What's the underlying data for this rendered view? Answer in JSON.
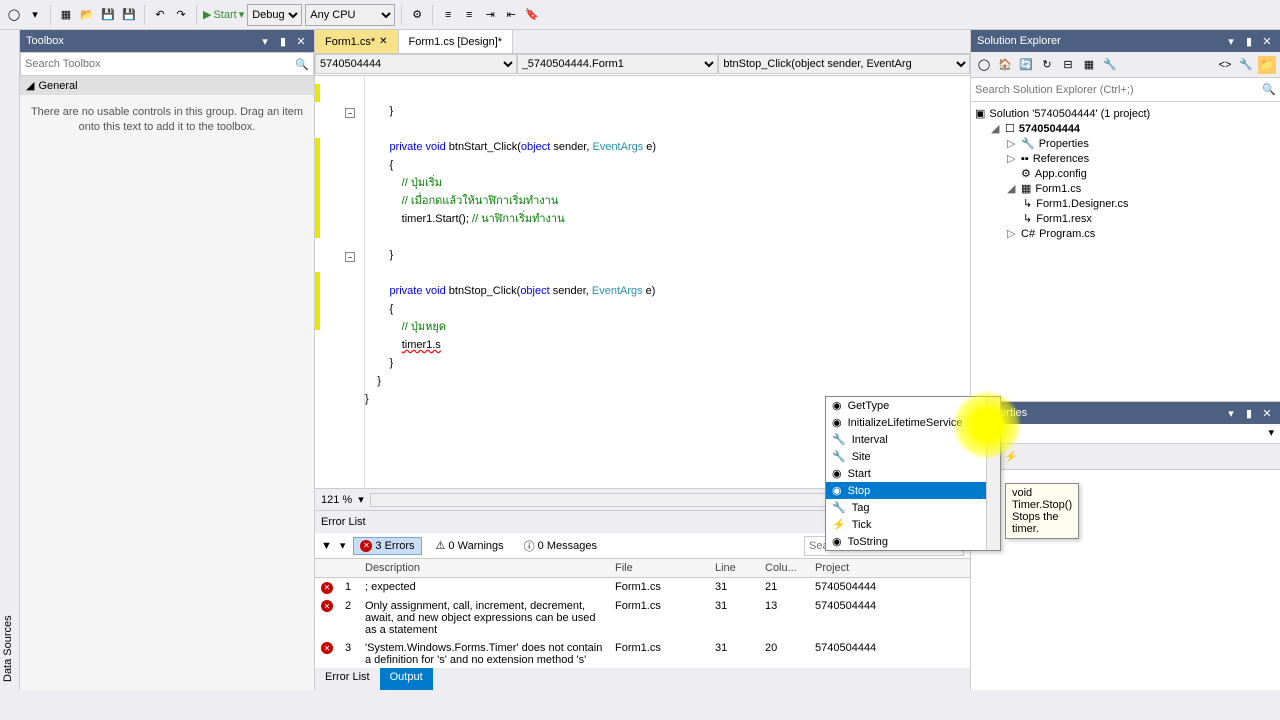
{
  "toolbar": {
    "start_label": "Start",
    "config": "Debug",
    "platform": "Any CPU"
  },
  "toolbox": {
    "title": "Toolbox",
    "search_placeholder": "Search Toolbox",
    "general_label": "General",
    "empty_msg": "There are no usable controls in this group. Drag an item onto this text to add it to the toolbox."
  },
  "data_sources_label": "Data Sources",
  "tabs": [
    {
      "label": "Form1.cs*",
      "active": true
    },
    {
      "label": "Form1.cs [Design]*",
      "active": false
    }
  ],
  "context": {
    "project": "5740504444",
    "class": "_5740504444.Form1",
    "member": "btnStop_Click(object sender, EventArg"
  },
  "code": {
    "line1": "        }",
    "blank": "",
    "m1_sig_pre": "        private void ",
    "m1_name": "btnStart_Click",
    "m1_args": "(object sender, ",
    "m1_arg2": "EventArgs",
    "m1_end": " e)",
    "open": "        {",
    "c1": "            // ปุ่มเริ่ม",
    "c2": "            // เมื่อกดแล้วให้นาฬิกาเริ่มทำงาน",
    "stmt1": "            timer1.Start(); ",
    "c3": "// นาฬิกาเริ่มทำงาน",
    "close": "        }",
    "m2_sig_pre": "        private void ",
    "m2_name": "btnStop_Click",
    "c4": "            // ปุ่มหยุด",
    "stmt2a": "            ",
    "stmt2b": "timer1.s",
    "close2": "    }",
    "close3": "}"
  },
  "intellisense": {
    "items": [
      {
        "label": "GetType",
        "kind": "method"
      },
      {
        "label": "InitializeLifetimeService",
        "kind": "method"
      },
      {
        "label": "Interval",
        "kind": "property"
      },
      {
        "label": "Site",
        "kind": "property"
      },
      {
        "label": "Start",
        "kind": "method"
      },
      {
        "label": "Stop",
        "kind": "method",
        "selected": true
      },
      {
        "label": "Tag",
        "kind": "property"
      },
      {
        "label": "Tick",
        "kind": "event"
      },
      {
        "label": "ToString",
        "kind": "method"
      }
    ],
    "tooltip_sig": "void Timer.Stop()",
    "tooltip_desc": "Stops the timer."
  },
  "zoom": "121 %",
  "error_list": {
    "title": "Error List",
    "errors_label": "3 Errors",
    "warnings_label": "0 Warnings",
    "messages_label": "0 Messages",
    "search_placeholder": "Search Error List",
    "columns": [
      "",
      "",
      "Description",
      "File",
      "Line",
      "Colu...",
      "Project"
    ],
    "rows": [
      {
        "n": "1",
        "desc": "; expected",
        "file": "Form1.cs",
        "line": "31",
        "col": "21",
        "proj": "5740504444"
      },
      {
        "n": "2",
        "desc": "Only assignment, call, increment, decrement, await, and new object expressions can be used as a statement",
        "file": "Form1.cs",
        "line": "31",
        "col": "13",
        "proj": "5740504444"
      },
      {
        "n": "3",
        "desc": "'System.Windows.Forms.Timer' does not contain a definition for 's' and no extension method 's'",
        "file": "Form1.cs",
        "line": "31",
        "col": "20",
        "proj": "5740504444"
      }
    ]
  },
  "bottom_tabs": {
    "error_list": "Error List",
    "output": "Output"
  },
  "solution_explorer": {
    "title": "Solution Explorer",
    "search_placeholder": "Search Solution Explorer (Ctrl+;)",
    "solution": "Solution '5740504444' (1 project)",
    "project": "5740504444",
    "properties": "Properties",
    "references": "References",
    "appconfig": "App.config",
    "form1": "Form1.cs",
    "designer": "Form1.Designer.cs",
    "resx": "Form1.resx",
    "program": "Program.cs"
  },
  "properties": {
    "title": "Properties"
  }
}
